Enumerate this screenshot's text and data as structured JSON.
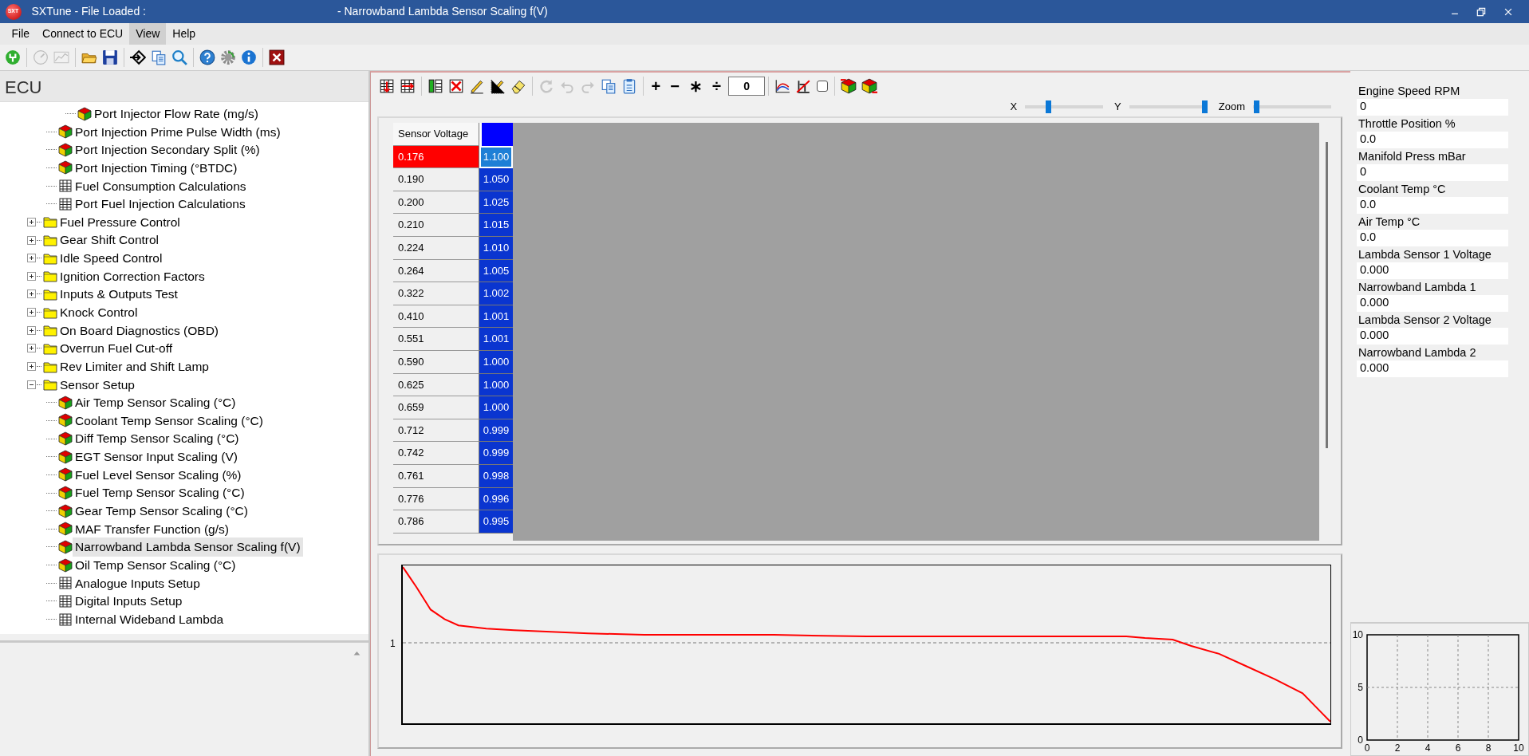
{
  "window": {
    "logo": "SXT",
    "title": "SXTune - File Loaded :",
    "subtitle": "- Narrowband Lambda Sensor Scaling f(V)"
  },
  "menu": [
    {
      "label": "File",
      "selected": false
    },
    {
      "label": "Connect to ECU",
      "selected": false
    },
    {
      "label": "View",
      "selected": true
    },
    {
      "label": "Help",
      "selected": false
    }
  ],
  "toolbar": {
    "groups": [
      [
        {
          "kind": "power",
          "disabled": false
        }
      ],
      [
        {
          "kind": "gauge",
          "disabled": true
        },
        {
          "kind": "chart",
          "disabled": true
        }
      ],
      [
        {
          "kind": "open",
          "disabled": false
        },
        {
          "kind": "save",
          "disabled": false
        }
      ],
      [
        {
          "kind": "enter",
          "disabled": false
        },
        {
          "kind": "copy",
          "disabled": false
        },
        {
          "kind": "search",
          "disabled": false
        }
      ],
      [
        {
          "kind": "help",
          "disabled": false
        },
        {
          "kind": "gear",
          "disabled": false
        },
        {
          "kind": "info",
          "disabled": false
        }
      ],
      [
        {
          "kind": "close",
          "disabled": false
        }
      ]
    ]
  },
  "sidebar": {
    "title": "ECU",
    "tree": [
      {
        "children": [
          {
            "children": [
              {
                "label": "Port Injector Flow Rate (mg/s)",
                "kind": "map",
                "selected": false
              }
            ]
          },
          {
            "label": "Port Injection Prime Pulse Width (ms)",
            "kind": "map",
            "selected": false
          },
          {
            "label": "Port Injection Secondary Split (%)",
            "kind": "map",
            "selected": false
          },
          {
            "label": "Port Injection Timing (°BTDC)",
            "kind": "map",
            "selected": false
          },
          {
            "label": "Fuel Consumption Calculations",
            "kind": "table",
            "selected": false
          },
          {
            "label": "Port Fuel Injection Calculations",
            "kind": "table",
            "selected": false
          }
        ]
      },
      {
        "label": "Fuel Pressure Control",
        "kind": "folder",
        "expanded": false,
        "selected": false
      },
      {
        "label": "Gear Shift Control",
        "kind": "folder",
        "expanded": false,
        "selected": false
      },
      {
        "label": "Idle Speed Control",
        "kind": "folder",
        "expanded": false,
        "selected": false
      },
      {
        "label": "Ignition Correction Factors",
        "kind": "folder",
        "expanded": false,
        "selected": false
      },
      {
        "label": "Inputs & Outputs Test",
        "kind": "folder",
        "expanded": false,
        "selected": false
      },
      {
        "label": "Knock Control",
        "kind": "folder",
        "expanded": false,
        "selected": false
      },
      {
        "label": "On Board Diagnostics (OBD)",
        "kind": "folder",
        "expanded": false,
        "selected": false
      },
      {
        "label": "Overrun Fuel Cut-off",
        "kind": "folder",
        "expanded": false,
        "selected": false
      },
      {
        "label": "Rev Limiter and Shift Lamp",
        "kind": "folder",
        "expanded": false,
        "selected": false
      },
      {
        "label": "Sensor Setup",
        "kind": "folder",
        "expanded": true,
        "selected": false,
        "children": [
          {
            "label": "Air Temp Sensor Scaling (°C)",
            "kind": "map",
            "selected": false
          },
          {
            "label": "Coolant Temp Sensor Scaling (°C)",
            "kind": "map",
            "selected": false
          },
          {
            "label": "Diff Temp Sensor Scaling (°C)",
            "kind": "map",
            "selected": false
          },
          {
            "label": "EGT Sensor Input Scaling (V)",
            "kind": "map",
            "selected": false
          },
          {
            "label": "Fuel Level Sensor Scaling (%)",
            "kind": "map",
            "selected": false
          },
          {
            "label": "Fuel Temp Sensor Scaling (°C)",
            "kind": "map",
            "selected": false
          },
          {
            "label": "Gear Temp Sensor Scaling (°C)",
            "kind": "map",
            "selected": false
          },
          {
            "label": "MAF Transfer Function (g/s)",
            "kind": "map",
            "selected": false
          },
          {
            "label": "Narrowband Lambda Sensor Scaling f(V)",
            "kind": "map",
            "selected": true
          },
          {
            "label": "Oil Temp Sensor Scaling (°C)",
            "kind": "map",
            "selected": false
          },
          {
            "label": "Analogue Inputs Setup",
            "kind": "table",
            "selected": false
          },
          {
            "label": "Digital Inputs Setup",
            "kind": "table",
            "selected": false
          },
          {
            "label": "Internal Wideband Lambda",
            "kind": "table",
            "selected": false
          }
        ]
      }
    ]
  },
  "editor_toolbar": {
    "groups": [
      [
        {
          "kind": "grid-down",
          "disabled": false
        },
        {
          "kind": "grid-right",
          "disabled": false
        }
      ],
      [
        {
          "kind": "column-add",
          "disabled": false
        },
        {
          "kind": "column-delete",
          "disabled": false
        },
        {
          "kind": "pencil",
          "disabled": false
        },
        {
          "kind": "pencil-grid",
          "disabled": false
        },
        {
          "kind": "eraser",
          "disabled": false
        }
      ],
      [
        {
          "kind": "refresh",
          "disabled": true
        },
        {
          "kind": "undo",
          "disabled": true
        },
        {
          "kind": "redo",
          "disabled": true
        },
        {
          "kind": "copy",
          "disabled": false
        },
        {
          "kind": "paste",
          "disabled": false
        }
      ],
      [
        {
          "kind": "op",
          "label": "+"
        },
        {
          "kind": "op",
          "label": "−"
        },
        {
          "kind": "op",
          "label": "∗"
        },
        {
          "kind": "op",
          "label": "÷"
        },
        {
          "kind": "input",
          "value": "0"
        }
      ],
      [
        {
          "kind": "line-chart"
        },
        {
          "kind": "no-chart"
        },
        {
          "kind": "checkbox",
          "checked": false
        }
      ],
      [
        {
          "kind": "cube-up"
        },
        {
          "kind": "cube-down"
        }
      ]
    ]
  },
  "sliders": [
    {
      "label": "X",
      "level": 0.3
    },
    {
      "label": "Y",
      "level": 0.96
    },
    {
      "label": "Zoom",
      "level": 0.04
    }
  ],
  "table": {
    "header": "Sensor Voltage",
    "rows": [
      {
        "voltage": "0.176",
        "value": "1.100",
        "selected": true
      },
      {
        "voltage": "0.190",
        "value": "1.050",
        "selected": false
      },
      {
        "voltage": "0.200",
        "value": "1.025",
        "selected": false
      },
      {
        "voltage": "0.210",
        "value": "1.015",
        "selected": false
      },
      {
        "voltage": "0.224",
        "value": "1.010",
        "selected": false
      },
      {
        "voltage": "0.264",
        "value": "1.005",
        "selected": false
      },
      {
        "voltage": "0.322",
        "value": "1.002",
        "selected": false
      },
      {
        "voltage": "0.410",
        "value": "1.001",
        "selected": false
      },
      {
        "voltage": "0.551",
        "value": "1.001",
        "selected": false
      },
      {
        "voltage": "0.590",
        "value": "1.000",
        "selected": false
      },
      {
        "voltage": "0.625",
        "value": "1.000",
        "selected": false
      },
      {
        "voltage": "0.659",
        "value": "1.000",
        "selected": false
      },
      {
        "voltage": "0.712",
        "value": "0.999",
        "selected": false
      },
      {
        "voltage": "0.742",
        "value": "0.999",
        "selected": false
      },
      {
        "voltage": "0.761",
        "value": "0.998",
        "selected": false
      },
      {
        "voltage": "0.776",
        "value": "0.996",
        "selected": false
      },
      {
        "voltage": "0.786",
        "value": "0.995",
        "selected": false
      }
    ]
  },
  "curve_chart": {
    "y_tick_label": "1"
  },
  "readouts": [
    {
      "label": "Engine Speed RPM",
      "value": "0"
    },
    {
      "label": "Throttle Position %",
      "value": "0.0"
    },
    {
      "label": "Manifold Press mBar",
      "value": "0"
    },
    {
      "label": "Coolant Temp °C",
      "value": "0.0"
    },
    {
      "label": "Air Temp °C",
      "value": "0.0"
    },
    {
      "label": "Lambda Sensor 1 Voltage",
      "value": "0.000"
    },
    {
      "label": "Narrowband Lambda 1",
      "value": "0.000"
    },
    {
      "label": "Lambda Sensor 2 Voltage",
      "value": "0.000"
    },
    {
      "label": "Narrowband Lambda 2",
      "value": "0.000"
    }
  ],
  "mini_chart": {
    "y_tick_labels": [
      "10",
      "5",
      "0"
    ],
    "x_tick_labels": [
      "0",
      "2",
      "4",
      "6",
      "8",
      "10"
    ]
  }
}
